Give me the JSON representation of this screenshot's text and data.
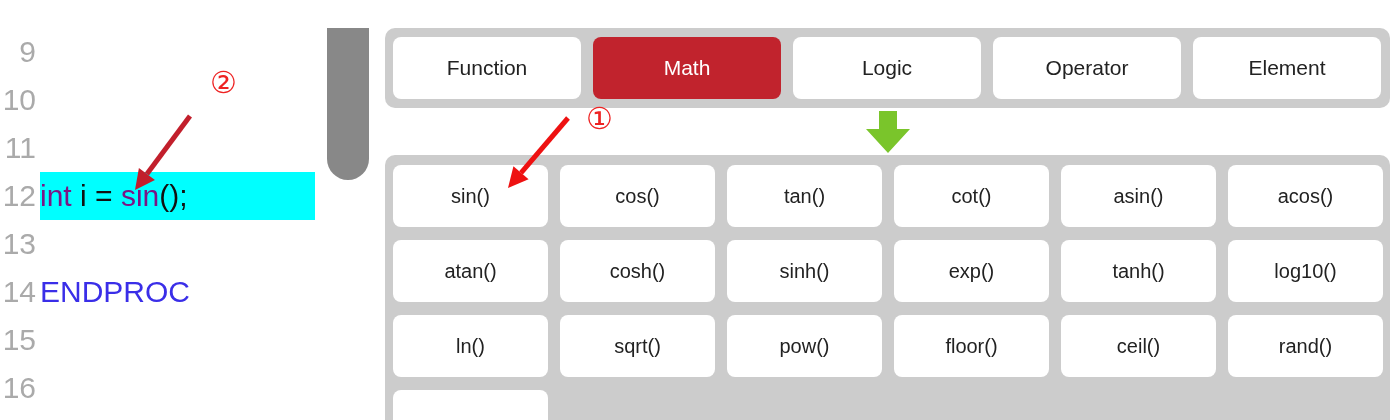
{
  "code_lines": [
    {
      "number": "9",
      "highlighted": false
    },
    {
      "number": "10",
      "highlighted": false
    },
    {
      "number": "11",
      "highlighted": false
    },
    {
      "number": "12",
      "highlighted": true,
      "tokens": [
        {
          "kind": "type",
          "text": "int"
        },
        {
          "kind": "plain",
          "text": " i = "
        },
        {
          "kind": "function",
          "text": "sin"
        },
        {
          "kind": "plain",
          "text": "();"
        }
      ]
    },
    {
      "number": "13",
      "highlighted": false
    },
    {
      "number": "14",
      "highlighted": false,
      "tokens": [
        {
          "kind": "keyword",
          "text": "ENDPROC"
        }
      ]
    },
    {
      "number": "15",
      "highlighted": false
    },
    {
      "number": "16",
      "highlighted": false
    }
  ],
  "tabs": [
    {
      "label": "Function",
      "selected": false
    },
    {
      "label": "Math",
      "selected": true
    },
    {
      "label": "Logic",
      "selected": false
    },
    {
      "label": "Operator",
      "selected": false
    },
    {
      "label": "Element",
      "selected": false
    }
  ],
  "functions": [
    "sin()",
    "cos()",
    "tan()",
    "cot()",
    "asin()",
    "acos()",
    "atan()",
    "cosh()",
    "sinh()",
    "exp()",
    "tanh()",
    "log10()",
    "ln()",
    "sqrt()",
    "pow()",
    "floor()",
    "ceil()",
    "rand()"
  ],
  "next_row_cut_off": true,
  "annotations": [
    {
      "text": "②"
    },
    {
      "text": "①"
    }
  ]
}
